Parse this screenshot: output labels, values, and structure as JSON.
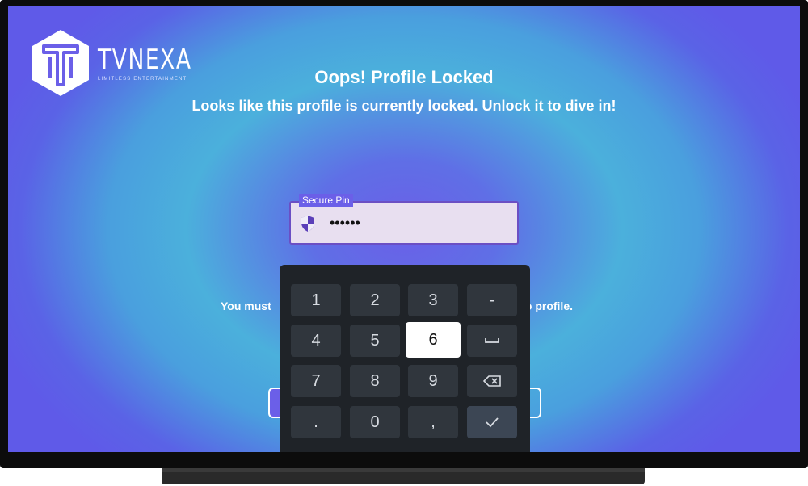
{
  "brand": {
    "name": "TVNEXA",
    "tagline": "LIMITLESS ENTERTAINMENT"
  },
  "header": {
    "title": "Oops! Profile Locked",
    "subtitle": "Looks like this profile is currently locked. Unlock it to dive in!"
  },
  "pin_field": {
    "label": "Secure Pin",
    "value": "••••••"
  },
  "note": {
    "left": "You must",
    "right": "io profile."
  },
  "keyboard": {
    "rows": [
      [
        "1",
        "2",
        "3",
        "-"
      ],
      [
        "4",
        "5",
        "6",
        "space"
      ],
      [
        "7",
        "8",
        "9",
        "backspace"
      ],
      [
        ".",
        "0",
        ",",
        "done"
      ]
    ],
    "focused_key": "6"
  },
  "colors": {
    "accent": "#6b5fe8",
    "field_border": "#6b4fc4",
    "keyboard_bg": "#1f2328",
    "key_bg": "#30363d"
  }
}
